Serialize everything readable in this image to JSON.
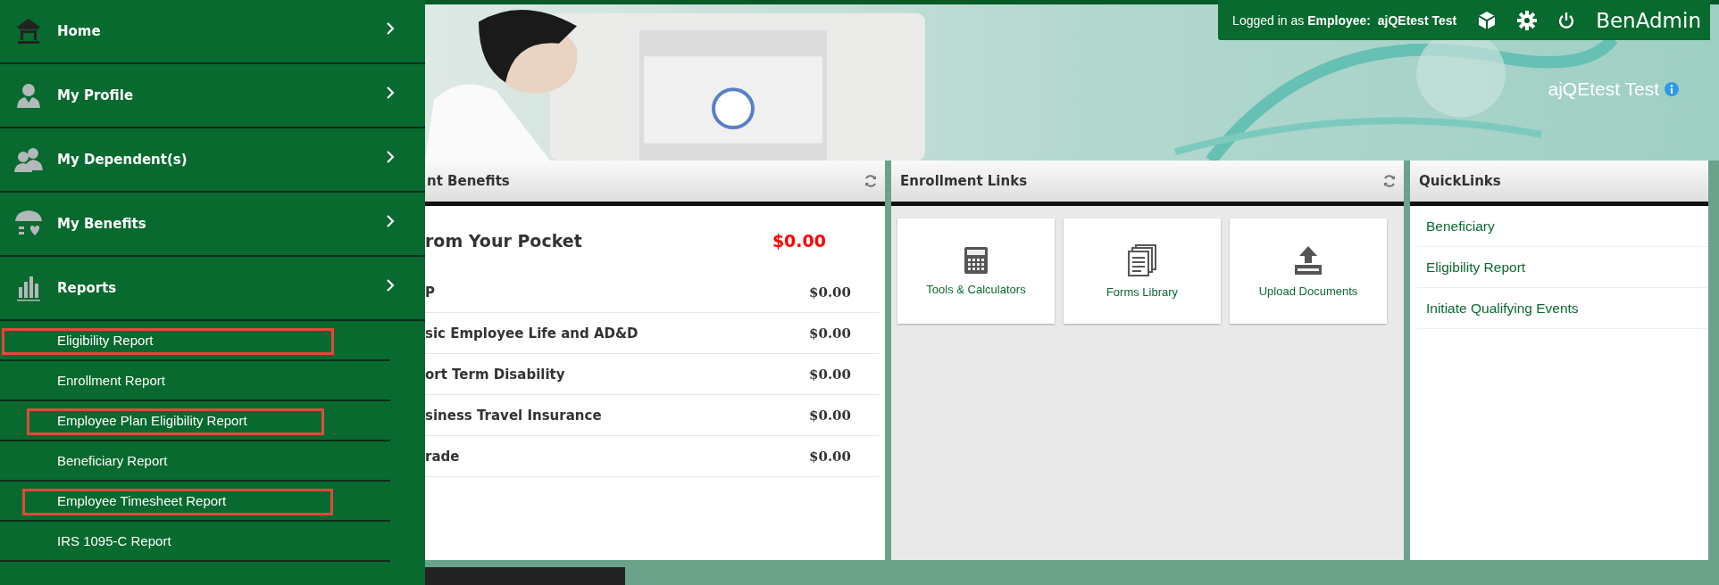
{
  "sidebar": {
    "items": [
      {
        "label": "Home"
      },
      {
        "label": "My Profile"
      },
      {
        "label": "My Dependent(s)"
      },
      {
        "label": "My Benefits"
      },
      {
        "label": "Reports",
        "children": [
          {
            "label": "Eligibility Report",
            "highlighted": true
          },
          {
            "label": "Enrollment Report",
            "highlighted": false
          },
          {
            "label": "Employee Plan Eligibility Report",
            "highlighted": true
          },
          {
            "label": "Beneficiary Report",
            "highlighted": false
          },
          {
            "label": "Employee Timesheet Report",
            "highlighted": true
          },
          {
            "label": "IRS 1095-C Report",
            "highlighted": false
          }
        ]
      }
    ]
  },
  "header": {
    "login": "Logged in as **Employee:  ajQEtest Test**",
    "brand": "BenAdmin",
    "user_name": "ajQEtest Test"
  },
  "benefits": {
    "title": "nt Benefits",
    "total": {
      "label": "rom Your Pocket",
      "amount": "$0.00"
    },
    "rows": [
      {
        "label": "P",
        "amount": "$0.00"
      },
      {
        "label": "sic Employee Life and AD&D",
        "amount": "$0.00"
      },
      {
        "label": "ort Term Disability",
        "amount": "$0.00"
      },
      {
        "label": "siness Travel Insurance",
        "amount": "$0.00"
      },
      {
        "label": "rade",
        "amount": "$0.00"
      }
    ]
  },
  "enrollment_links": {
    "title": "Enrollment Links",
    "tiles": [
      {
        "label": "Tools & Calculators"
      },
      {
        "label": "Forms Library"
      },
      {
        "label": "Upload Documents"
      }
    ]
  },
  "quicklinks": {
    "title": "QuickLinks",
    "links": [
      "Beneficiary",
      "Eligibility Report",
      "Initiate Qualifying Events"
    ]
  }
}
